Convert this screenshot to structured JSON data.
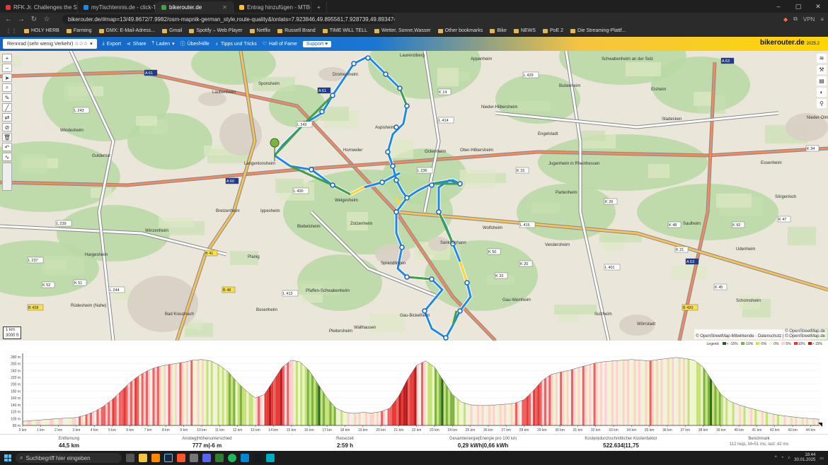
{
  "browser": {
    "tabs": [
      {
        "label": "RFK Jr. Challenges the System W",
        "color": "#e53935",
        "active": false
      },
      {
        "label": "myTischtennis.de - click-TT - Binge",
        "color": "#1e88e5",
        "active": false
      },
      {
        "label": "bikerouter.de",
        "color": "#43a047",
        "active": true
      },
      {
        "label": "Entrag hinzufügen - MTB-News W",
        "color": "#fbc02d",
        "active": false
      }
    ],
    "url": "bikerouter.de/#map=13/49.8672/7.9982/osm-mapnik-german_style,route-quality&lonlats=7.923846,49.895561;7.928739,49.893474;7.937225,49.893625;...",
    "vpn_label": "VPN",
    "bookmarks": [
      "HOLY HERB",
      "Farming",
      "GMX: E-Mail-Adress...",
      "Gmail",
      "Spotify – Web Player",
      "Netflix",
      "Russell Brand",
      "TIME WILL TELL",
      "Wetter, Sonne,Wasser",
      "Other bookmarks",
      "Bike",
      "NEWS",
      "PoE 2",
      "Die Streaming-Plattf..."
    ]
  },
  "app": {
    "profile": "Rennrad (sehr wenig Verkehr) ☆☆☆",
    "buttons": [
      "Export",
      "Share",
      "Laden",
      "Über/Hilfe",
      "Tipps und Tricks",
      "Hall of Fame"
    ],
    "support": "Support ♥",
    "brand": "bikerouter.de",
    "version": "2025.2"
  },
  "map": {
    "places": [
      {
        "name": "Laurenziberg",
        "x": 565,
        "y": 80
      },
      {
        "name": "Appenheim",
        "x": 665,
        "y": 85
      },
      {
        "name": "Dromersheim",
        "x": 470,
        "y": 107
      },
      {
        "name": "Sponsheim",
        "x": 365,
        "y": 120
      },
      {
        "name": "Laubenheim",
        "x": 300,
        "y": 132
      },
      {
        "name": "Schwabenheim an der Selz",
        "x": 850,
        "y": 85
      },
      {
        "name": "Bubenheim",
        "x": 790,
        "y": 123
      },
      {
        "name": "Elsheim",
        "x": 920,
        "y": 128
      },
      {
        "name": "Nieder-Hilbersheim",
        "x": 680,
        "y": 153
      },
      {
        "name": "Stadecken",
        "x": 935,
        "y": 170
      },
      {
        "name": "Nieder-Olm",
        "x": 1140,
        "y": 168
      },
      {
        "name": "Windesheim",
        "x": 85,
        "y": 186
      },
      {
        "name": "Aspisheim",
        "x": 530,
        "y": 182
      },
      {
        "name": "Engelstadt",
        "x": 760,
        "y": 191
      },
      {
        "name": "Horrweiler",
        "x": 485,
        "y": 214
      },
      {
        "name": "Ober-Hilbersheim",
        "x": 650,
        "y": 214
      },
      {
        "name": "Guldental",
        "x": 130,
        "y": 222
      },
      {
        "name": "Langenlonsheim",
        "x": 345,
        "y": 233
      },
      {
        "name": "Jugenheim in Rheinhessen",
        "x": 775,
        "y": 233
      },
      {
        "name": "Essenheim",
        "x": 1075,
        "y": 232
      },
      {
        "name": "Partenheim",
        "x": 785,
        "y": 274
      },
      {
        "name": "Ockenheim",
        "x": 600,
        "y": 216
      },
      {
        "name": "Welgesheim",
        "x": 473,
        "y": 285
      },
      {
        "name": "Sörgenloch",
        "x": 1095,
        "y": 280
      },
      {
        "name": "Bretzenheim",
        "x": 305,
        "y": 300
      },
      {
        "name": "Zotzenheim",
        "x": 495,
        "y": 318
      },
      {
        "name": "Ippesheim",
        "x": 368,
        "y": 300
      },
      {
        "name": "Winzenheim",
        "x": 205,
        "y": 328
      },
      {
        "name": "Biebelsheim",
        "x": 420,
        "y": 322
      },
      {
        "name": "Wolfsheim",
        "x": 682,
        "y": 324
      },
      {
        "name": "Saulheim",
        "x": 965,
        "y": 318
      },
      {
        "name": "Sankt Johann",
        "x": 622,
        "y": 345
      },
      {
        "name": "Vendersheim",
        "x": 770,
        "y": 348
      },
      {
        "name": "Udenheim",
        "x": 1040,
        "y": 354
      },
      {
        "name": "Hargesheim",
        "x": 120,
        "y": 362
      },
      {
        "name": "Planig",
        "x": 350,
        "y": 365
      },
      {
        "name": "Sprendlingen",
        "x": 538,
        "y": 374
      },
      {
        "name": "Schornsheim",
        "x": 1040,
        "y": 427
      },
      {
        "name": "Pfaffen-Schwabenheim",
        "x": 432,
        "y": 413
      },
      {
        "name": "Bad Kreuznach",
        "x": 233,
        "y": 446
      },
      {
        "name": "Bosenheim",
        "x": 362,
        "y": 440
      },
      {
        "name": "Rüdesheim (Nahe)",
        "x": 100,
        "y": 434
      },
      {
        "name": "Gau-Weinheim",
        "x": 710,
        "y": 426
      },
      {
        "name": "Sulzheim",
        "x": 840,
        "y": 446
      },
      {
        "name": "Wörrstadt",
        "x": 900,
        "y": 460
      },
      {
        "name": "Gau-Bickelheim",
        "x": 565,
        "y": 448
      },
      {
        "name": "Wallhausen",
        "x": 500,
        "y": 465
      },
      {
        "name": "Pleitersheim",
        "x": 465,
        "y": 470
      }
    ],
    "roads": [
      "A 61",
      "A 61",
      "A 60",
      "A 63",
      "A 63",
      "B 41",
      "B 48",
      "B 428",
      "B 420",
      "L 242",
      "L 400",
      "L 413",
      "L 414",
      "L 415",
      "L 401",
      "L 429",
      "L 236",
      "K 47",
      "K 45",
      "K 48",
      "K 92",
      "K 26",
      "K 50",
      "K 33",
      "K 20",
      "K 34",
      "K 52",
      "K 51",
      "K 14",
      "K 15",
      "K 21",
      "L 243",
      "L 239",
      "L 237",
      "L 244"
    ],
    "scale_km": "1 km",
    "scale_ft": "3000 ft",
    "attribution": "© OpenStreetMap-Mitwirkende · Datenschutz | © OpenStreetMap.de",
    "attribution_top": "© OpenStreetMap.de"
  },
  "elevation": {
    "legend_title": "Legend:",
    "legend": [
      {
        "label": "< -15%",
        "color": "#1b5e20"
      },
      {
        "label": "-10%",
        "color": "#7cb342"
      },
      {
        "label": "-5%",
        "color": "#d4e157"
      },
      {
        "label": "0%",
        "color": "#f5f5dc"
      },
      {
        "label": "5%",
        "color": "#ffcdd2"
      },
      {
        "label": "10%",
        "color": "#e53935"
      },
      {
        "label": "> 15%",
        "color": "#b71c1c"
      }
    ],
    "y_ticks": [
      "280 m",
      "260 m",
      "240 m",
      "220 m",
      "200 m",
      "180 m",
      "160 m",
      "140 m",
      "120 m",
      "100 m",
      "80 m"
    ],
    "x_ticks": [
      "0 km",
      "1 km",
      "2 km",
      "3 km",
      "4 km",
      "5 km",
      "6 km",
      "7 km",
      "8 km",
      "9 km",
      "10 km",
      "11 km",
      "12 km",
      "13 km",
      "14 km",
      "15 km",
      "16 km",
      "17 km",
      "18 km",
      "19 km",
      "20 km",
      "21 km",
      "22 km",
      "23 km",
      "24 km",
      "25 km",
      "26 km",
      "27 km",
      "28 km",
      "29 km",
      "30 km",
      "31 km",
      "32 km",
      "33 km",
      "34 km",
      "35 km",
      "36 km",
      "37 km",
      "38 km",
      "39 km",
      "40 km",
      "41 km",
      "42 km",
      "43 km",
      "44 km"
    ]
  },
  "chart_data": {
    "type": "area",
    "xlabel": "",
    "ylabel": "",
    "xlim": [
      0,
      44.5
    ],
    "ylim": [
      80,
      290
    ],
    "x": [
      0,
      1,
      2,
      3,
      3.5,
      4,
      4.5,
      5,
      5.5,
      6,
      6.5,
      7,
      7.5,
      8,
      8.5,
      9,
      9.5,
      10,
      10.5,
      11,
      11.5,
      12,
      12.5,
      13,
      13.5,
      14,
      14.5,
      15,
      15.5,
      16,
      16.5,
      17,
      17.5,
      18,
      18.5,
      19,
      19.5,
      20,
      20.5,
      21,
      21.5,
      22,
      22.5,
      23,
      23.5,
      24,
      24.5,
      25,
      25.5,
      26,
      26.5,
      27,
      27.5,
      28,
      28.5,
      29,
      29.5,
      30,
      30.5,
      31,
      31.5,
      32,
      32.5,
      33,
      33.5,
      34,
      34.5,
      35,
      35.5,
      36,
      36.5,
      37,
      37.5,
      38,
      38.5,
      39,
      39.5,
      40,
      40.5,
      41,
      41.5,
      42,
      42.5,
      43,
      43.5,
      44,
      44.5
    ],
    "y": [
      92,
      96,
      100,
      103,
      110,
      120,
      135,
      155,
      180,
      205,
      225,
      240,
      250,
      256,
      260,
      264,
      270,
      272,
      268,
      255,
      235,
      205,
      180,
      160,
      170,
      210,
      250,
      270,
      265,
      240,
      200,
      160,
      130,
      118,
      115,
      118,
      116,
      120,
      130,
      165,
      215,
      255,
      268,
      250,
      210,
      170,
      148,
      140,
      138,
      138,
      140,
      142,
      145,
      155,
      180,
      210,
      228,
      235,
      240,
      248,
      255,
      262,
      266,
      268,
      270,
      272,
      270,
      268,
      272,
      275,
      278,
      275,
      270,
      250,
      210,
      170,
      150,
      140,
      132,
      125,
      118,
      112,
      108,
      105,
      102,
      100,
      98
    ]
  },
  "stats": [
    {
      "label": "Entfernung",
      "value": "44,5 km"
    },
    {
      "label": "Anstieg|Höhenunterschied",
      "value": "777 m|-6 m"
    },
    {
      "label": "Reisezeit",
      "value": "2:59 h"
    },
    {
      "label": "Gesamtenergie|Energie pro 100 km",
      "value": "0,29 kWh|0,66 kWh"
    },
    {
      "label": "Kosten|durchschnittlicher Kostenfaktor",
      "value": "522.634|11,75"
    },
    {
      "label": "Benchmark",
      "value": "112 reqs, M=51 ms, last: 42 ms"
    }
  ],
  "taskbar": {
    "search_placeholder": "Suchbegriff hier eingeben",
    "time": "18:44",
    "date": "30.01.2025"
  }
}
